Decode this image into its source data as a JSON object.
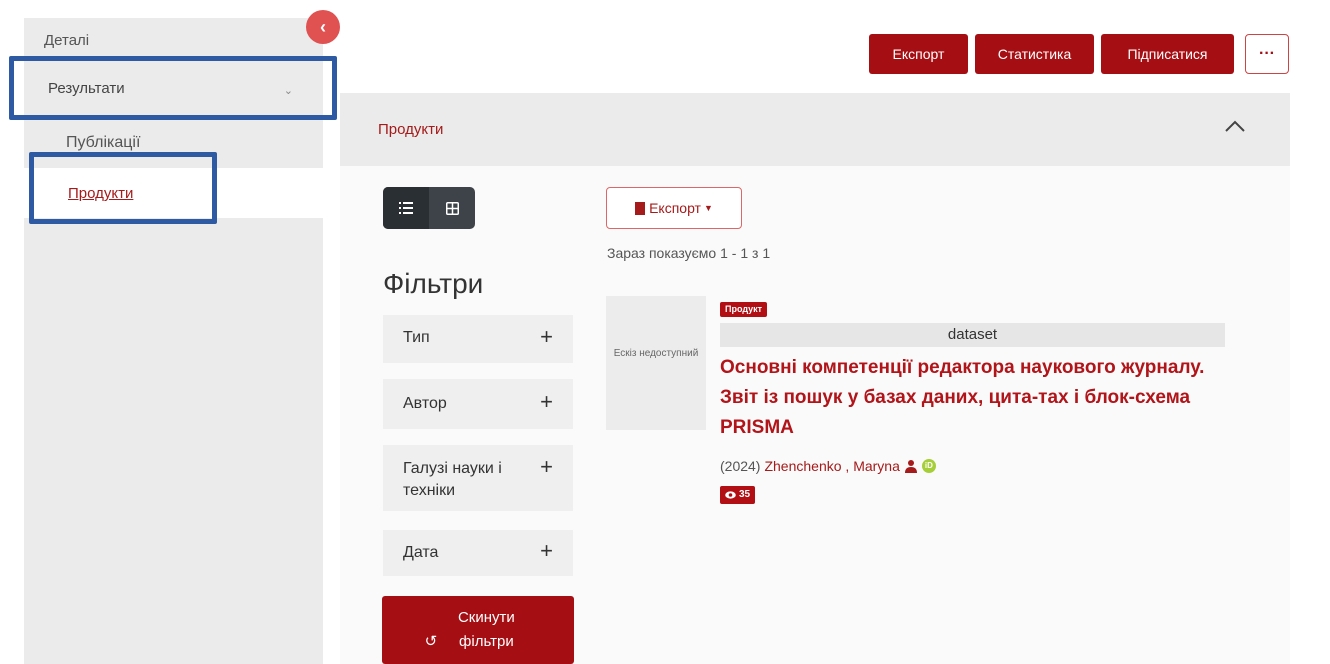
{
  "sidebar": {
    "details": "Деталі",
    "results": "Результати",
    "results_caret": "⌄",
    "publications": "Публікації",
    "products": "Продукти"
  },
  "toolbar": {
    "export": "Експорт",
    "statistics": "Статистика",
    "subscribe": "Підписатися",
    "more": "···"
  },
  "panel": {
    "title": "Продукти"
  },
  "filters": {
    "title": "Фільтри",
    "items": [
      {
        "label": "Тип"
      },
      {
        "label": "Автор"
      },
      {
        "label": "Галузі науки і техніки"
      },
      {
        "label": "Дата"
      }
    ],
    "reset_label": "Скинути фільтри"
  },
  "results": {
    "export_label": "Експорт",
    "showing": "Зараз показуємо 1 - 1 з 1",
    "item": {
      "thumbnail_text": "Ескіз недоступний",
      "badge": "Продукт",
      "type": "dataset",
      "title": "Основні компетенції редактора наукового журналу. Звіт із пошук у базах даних, цита-тах і блок-схема PRISMA",
      "year": "(2024)",
      "author": "Zhenchenko , Maryna",
      "views": "35"
    }
  },
  "colors": {
    "accent": "#a50f13",
    "highlight_box": "#2d5aa3"
  }
}
